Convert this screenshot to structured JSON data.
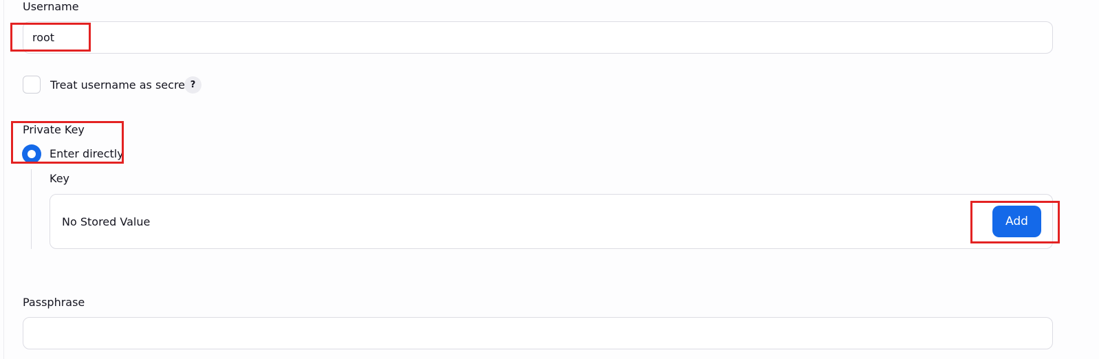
{
  "form": {
    "username": {
      "label": "Username",
      "value": "root"
    },
    "treat_secret": {
      "label": "Treat username as secret",
      "checked": false,
      "help_glyph": "?"
    },
    "private_key": {
      "label": "Private Key",
      "option_label": "Enter directly",
      "selected": true,
      "key": {
        "label": "Key",
        "stored_value_text": "No Stored Value",
        "add_button_label": "Add"
      }
    },
    "passphrase": {
      "label": "Passphrase",
      "value": ""
    }
  },
  "colors": {
    "accent": "#1469e9",
    "highlight": "#e32222",
    "border": "#dcdce3"
  }
}
